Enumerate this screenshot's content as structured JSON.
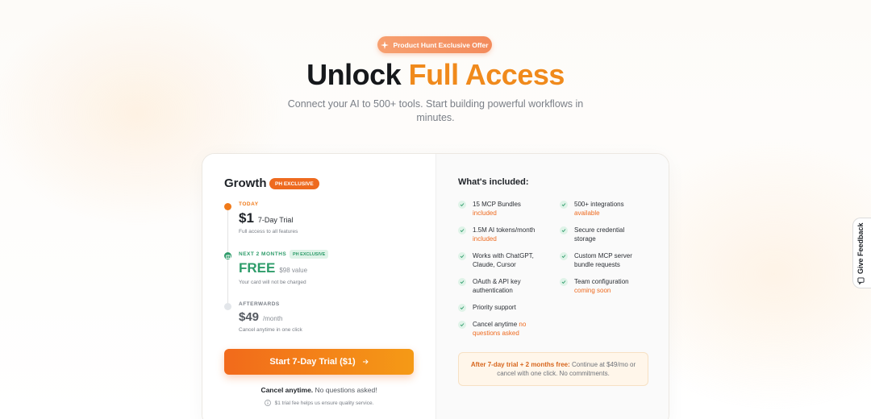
{
  "colors": {
    "accent": "#f08a1c",
    "green": "#2e9c6a",
    "badge": "#ee6a1f"
  },
  "hero": {
    "badge": "Product Hunt Exclusive Offer",
    "headline_part1": "Unlock ",
    "headline_part2": "Full Access",
    "subhead": "Connect your AI to 500+ tools. Start building powerful workflows in minutes."
  },
  "plan": {
    "name": "Growth",
    "badge": "PH EXCLUSIVE",
    "steps": [
      {
        "label": "TODAY",
        "price": "$1",
        "note": "7-Day Trial",
        "desc": "Full access to all features"
      },
      {
        "label": "NEXT 2 MONTHS",
        "badge": "PH EXCLUSIVE",
        "price": "FREE",
        "note": "$98 value",
        "desc": "Your card will not be charged"
      },
      {
        "label": "AFTERWARDS",
        "price": "$49",
        "note": "/month",
        "desc": "Cancel anytime in one click"
      }
    ],
    "cta": "Start 7-Day Trial ($1)",
    "cancel_bold": "Cancel anytime.",
    "cancel_rest": " No questions asked!",
    "fee_note": "$1 trial fee helps us ensure quality service."
  },
  "included": {
    "title": "What's included:",
    "features": [
      {
        "text": "15 MCP Bundles",
        "highlight": "included"
      },
      {
        "text": "500+ integrations",
        "highlight": "available"
      },
      {
        "text": "1.5M AI tokens/month",
        "highlight": "included"
      },
      {
        "text": "Secure credential storage",
        "highlight": ""
      },
      {
        "text": "Works with ChatGPT, Claude, Cursor",
        "highlight": ""
      },
      {
        "text": "Custom MCP server bundle requests",
        "highlight": ""
      },
      {
        "text": "OAuth & API key authentication",
        "highlight": ""
      },
      {
        "text": "Team configuration",
        "highlight": "coming soon"
      },
      {
        "text": "Priority support",
        "highlight": ""
      },
      {
        "text": "Cancel anytime",
        "highlight": "no questions asked"
      }
    ],
    "note_bold": "After 7-day trial + 2 months free:",
    "note_rest": " Continue at $49/mo or cancel with one click. No commitments."
  },
  "feedback": {
    "label": "Give Feedback",
    "icon": "feedback-icon"
  }
}
